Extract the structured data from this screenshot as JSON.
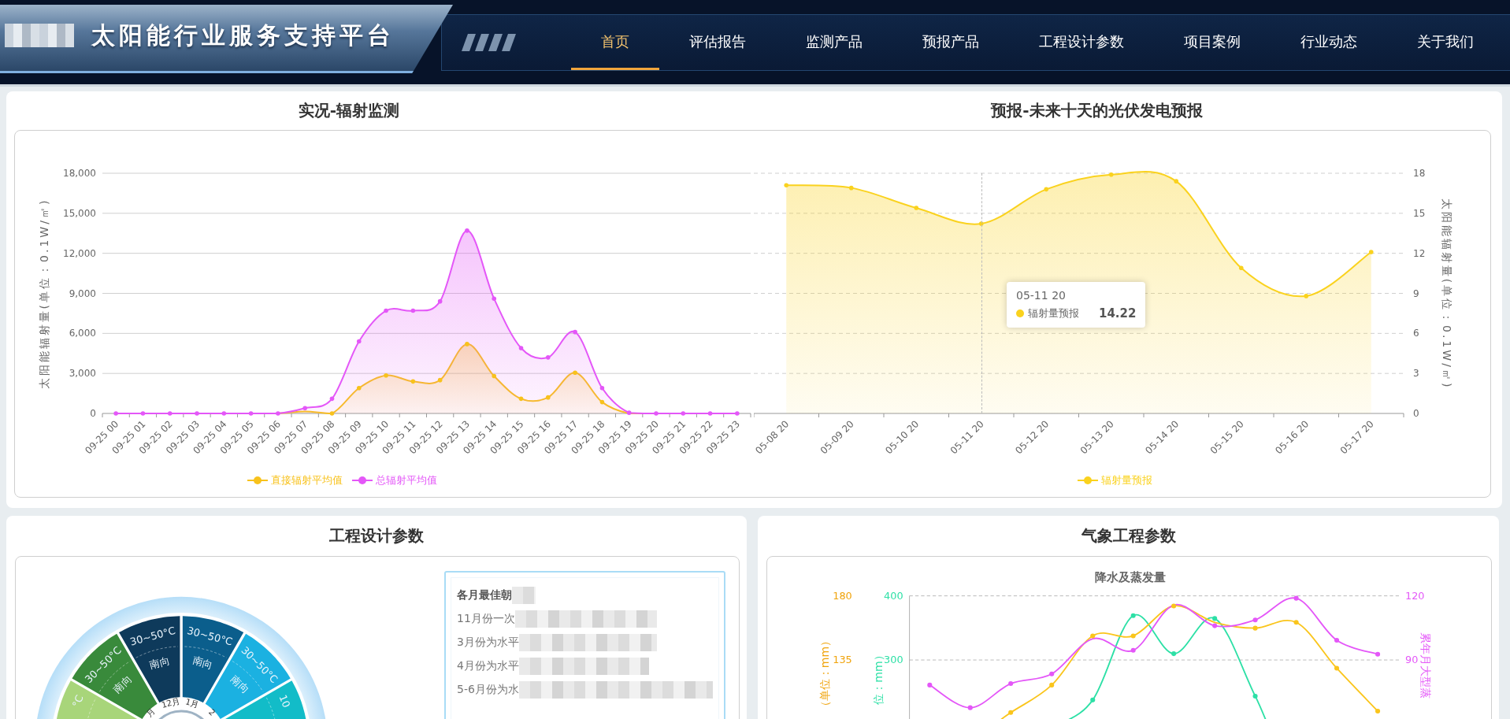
{
  "header": {
    "title": "太阳能行业服务支持平台",
    "nav": [
      {
        "label": "首页",
        "selected": true
      },
      {
        "label": "评估报告",
        "selected": false
      },
      {
        "label": "监测产品",
        "selected": false
      },
      {
        "label": "预报产品",
        "selected": false
      },
      {
        "label": "工程设计参数",
        "selected": false
      },
      {
        "label": "项目案例",
        "selected": false
      },
      {
        "label": "行业动态",
        "selected": false
      },
      {
        "label": "关于我们",
        "selected": false
      }
    ]
  },
  "radiation_monitoring": {
    "title": "实况-辐射监测",
    "chart_data": {
      "type": "area",
      "ylabel": "太阳能辐射量(单位：0.1W/㎡)",
      "categories": [
        "09-25 00",
        "09-25 01",
        "09-25 02",
        "09-25 03",
        "09-25 04",
        "09-25 05",
        "09-25 06",
        "09-25 07",
        "09-25 08",
        "09-25 09",
        "09-25 10",
        "09-25 11",
        "09-25 12",
        "09-25 13",
        "09-25 14",
        "09-25 15",
        "09-25 16",
        "09-25 17",
        "09-25 18",
        "09-25 19",
        "09-25 20",
        "09-25 21",
        "09-25 22",
        "09-25 23"
      ],
      "series": [
        {
          "name": "直接辐射平均值",
          "color": "#f8c21c",
          "values": [
            0,
            0,
            0,
            0,
            0,
            0,
            0,
            150,
            0,
            1900,
            2850,
            2400,
            2500,
            5200,
            2800,
            1100,
            1200,
            3050,
            850,
            0,
            0,
            0,
            0,
            0
          ]
        },
        {
          "name": "总辐射平均值",
          "color": "#e457f8",
          "values": [
            0,
            0,
            0,
            0,
            0,
            0,
            0,
            400,
            1100,
            5400,
            7700,
            7700,
            8400,
            13700,
            8600,
            4900,
            4200,
            6100,
            1900,
            50,
            0,
            0,
            0,
            0
          ]
        }
      ],
      "ylim": [
        0,
        18000
      ],
      "grid": true,
      "yticks": [
        {
          "value": 0,
          "label": "0"
        },
        {
          "value": 3000,
          "label": "3,000"
        },
        {
          "value": 6000,
          "label": "6,000"
        },
        {
          "value": 9000,
          "label": "9,000"
        },
        {
          "value": 12000,
          "label": "12,000"
        },
        {
          "value": 15000,
          "label": "15,000"
        },
        {
          "value": 18000,
          "label": "18,000"
        }
      ]
    }
  },
  "pv_forecast": {
    "title": "预报-未来十天的光伏发电预报",
    "chart_data": {
      "type": "area",
      "ylabel": "太阳能辐射量(单位：0.1W/㎡)",
      "categories": [
        "05-08 20",
        "05-09 20",
        "05-10 20",
        "05-11 20",
        "05-12 20",
        "05-13 20",
        "05-14 20",
        "05-15 20",
        "05-16 20",
        "05-17 20"
      ],
      "series": [
        {
          "name": "辐射量预报",
          "color": "#fad21e",
          "values": [
            17.1,
            16.9,
            15.4,
            14.22,
            16.8,
            17.9,
            17.4,
            10.9,
            8.8,
            12.1
          ]
        }
      ],
      "ylim": [
        0,
        18
      ],
      "grid": true,
      "yticks": [
        0,
        3,
        6,
        9,
        12,
        15,
        18
      ]
    },
    "tooltip": {
      "title": "05-11 20",
      "label": "辐射量预报",
      "value": "14.22"
    }
  },
  "design_parameters": {
    "title": "工程设计参数",
    "segments": [
      {
        "color": "#a8d57a",
        "temperature": "°C"
      },
      {
        "color": "#398a3b",
        "temperature": "30~50°C",
        "orientation": "南向",
        "month": "月"
      },
      {
        "color": "#0e3a5b",
        "temperature": "30~50°C",
        "orientation": "南向",
        "month": "12月"
      },
      {
        "color": "#0b5e8c",
        "temperature": "30~50°C",
        "orientation": "南向",
        "month": "1月"
      },
      {
        "color": "#1bb1e1",
        "temperature": "30~50°C",
        "orientation": "南向",
        "month": "2"
      },
      {
        "color": "#12bcc8",
        "temperature": "10"
      }
    ],
    "info": {
      "title": "各月最佳朝",
      "lines": [
        "11月份一次",
        "3月份为水平",
        "4月份为水平",
        "5-6月份为水"
      ]
    }
  },
  "weather": {
    "title": "气象工程参数",
    "chart_title": "降水及蒸发量",
    "axes": [
      {
        "title": "（单位：mm）",
        "ticks": [
          "180",
          "135"
        ]
      },
      {
        "title": "位：mm）",
        "ticks": [
          "400",
          "300"
        ]
      },
      {
        "title": "累年月大型蒸",
        "ticks": [
          "120",
          "90"
        ]
      }
    ]
  }
}
